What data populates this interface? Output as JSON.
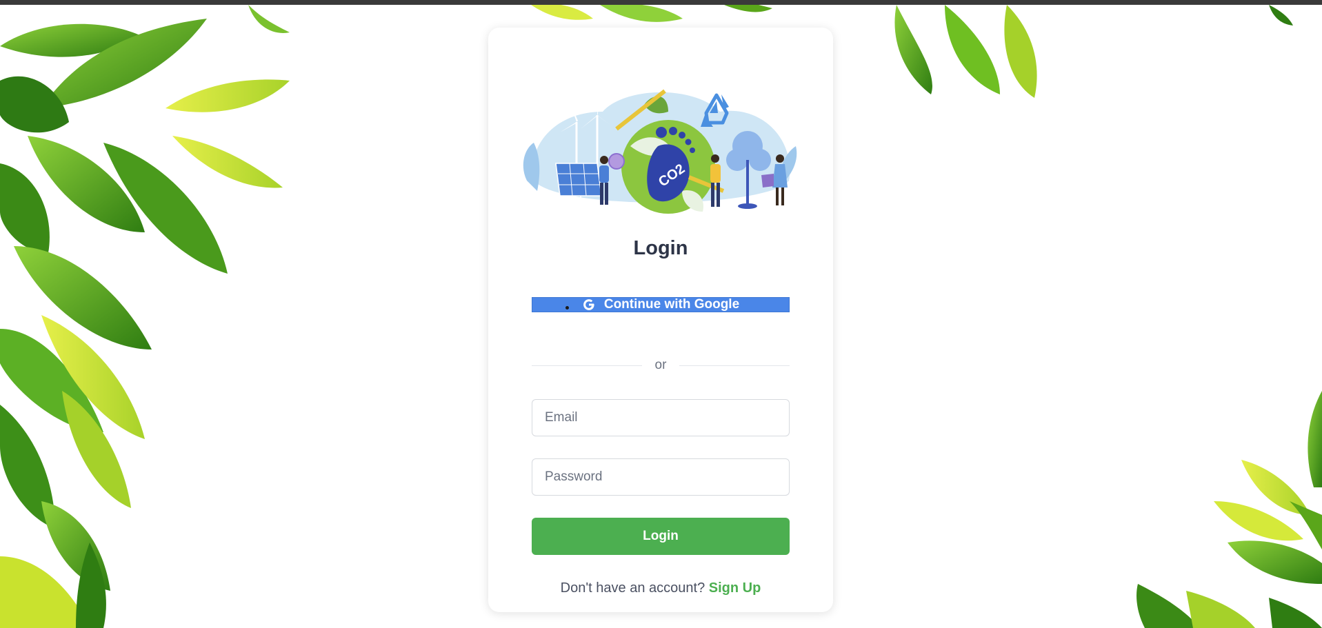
{
  "colors": {
    "accent_green": "#4caf50",
    "google_blue": "#4a86e8",
    "title_color": "#2d3447",
    "leaf_green": "#5aa61a",
    "leaf_yellow": "#c8e02a"
  },
  "login": {
    "title": "Login",
    "google_button_label": "Continue with Google",
    "google_icon": "google-g-icon",
    "divider_text": "or",
    "email_placeholder": "Email",
    "password_placeholder": "Password",
    "submit_label": "Login",
    "signup_prompt": "Don't have an account?",
    "signup_link": "Sign Up"
  },
  "illustration": {
    "badge_text": "CO2"
  }
}
